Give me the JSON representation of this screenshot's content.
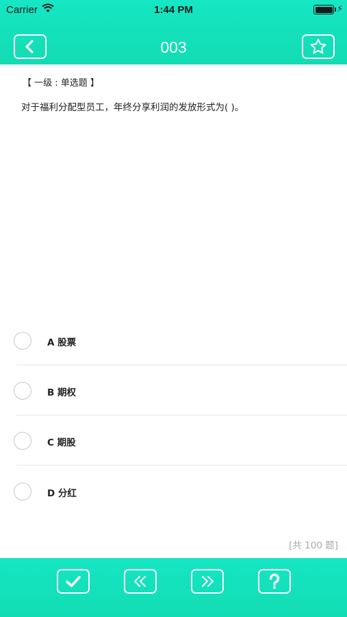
{
  "status_bar": {
    "carrier": "Carrier",
    "time": "1:44 PM"
  },
  "nav": {
    "title": "003",
    "back_icon": "chevron-left-icon",
    "favorite_icon": "star-icon"
  },
  "question": {
    "type_label": "【 一级 : 单选题 】",
    "text": "对于福利分配型员工，年终分享利润的发放形式为(    )。",
    "options": [
      {
        "label": "A 股票",
        "selected": false
      },
      {
        "label": "B 期权",
        "selected": false
      },
      {
        "label": "C 期股",
        "selected": false
      },
      {
        "label": "D 分红",
        "selected": false
      }
    ]
  },
  "total_count": "[共 100 题]",
  "toolbar": {
    "buttons": [
      {
        "icon": "check-icon"
      },
      {
        "icon": "double-chevron-left-icon"
      },
      {
        "icon": "double-chevron-right-icon"
      },
      {
        "icon": "question-mark-icon"
      }
    ]
  },
  "colors": {
    "accent": "#14e0bb",
    "text": "#222222",
    "muted": "#a8a8a8"
  }
}
